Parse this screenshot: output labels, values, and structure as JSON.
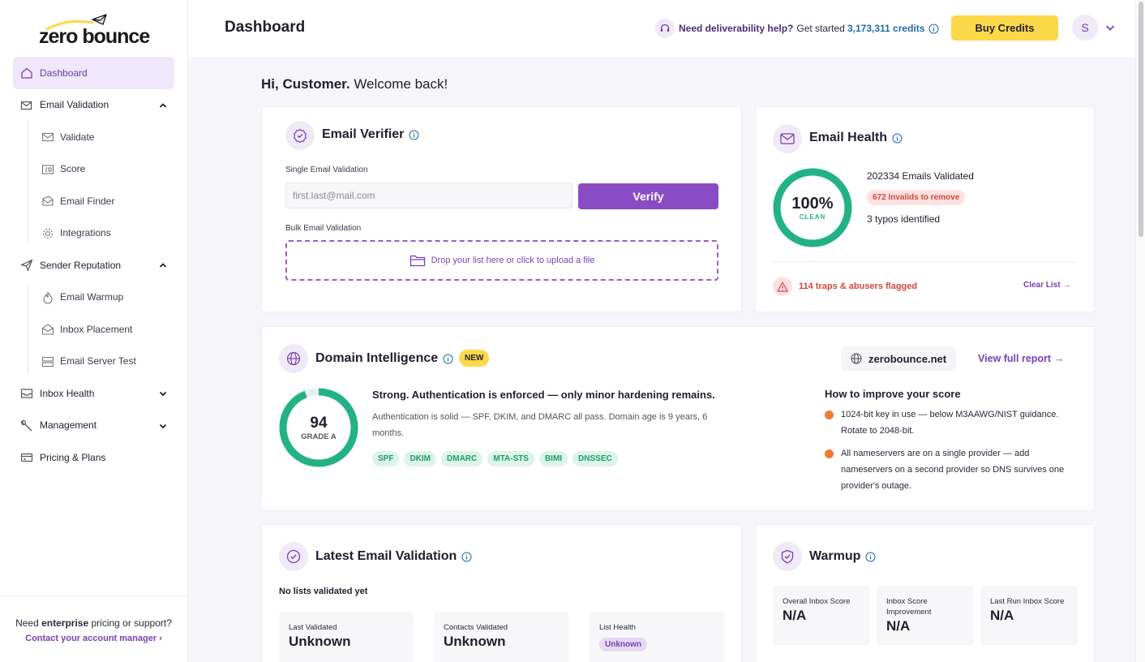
{
  "brand": {
    "logo_text": "zero bounce",
    "accent": "#8a4cc4",
    "yellow": "#fbd94a",
    "green": "#22b286"
  },
  "sidebar": {
    "items": [
      {
        "label": "Dashboard"
      },
      {
        "label": "Email Validation"
      },
      {
        "label": "Validate"
      },
      {
        "label": "Score"
      },
      {
        "label": "Email Finder"
      },
      {
        "label": "Integrations"
      },
      {
        "label": "Sender Reputation"
      },
      {
        "label": "Email Warmup"
      },
      {
        "label": "Inbox Placement"
      },
      {
        "label": "Email Server Test"
      },
      {
        "label": "Inbox Health"
      },
      {
        "label": "Management"
      },
      {
        "label": "Pricing & Plans"
      }
    ],
    "footer": {
      "pre": "Need ",
      "bold": "enterprise",
      "post": " pricing or support?",
      "link": "Contact your account manager ›"
    }
  },
  "header": {
    "title": "Dashboard",
    "help_bold": "Need deliverability help?",
    "help_link": "Get started",
    "credits": "3,173,311 credits",
    "buy_label": "Buy Credits",
    "avatar_initial": "S"
  },
  "greeting": {
    "bold": "Hi, Customer.",
    "rest": " Welcome back!"
  },
  "email_verifier": {
    "title": "Email Verifier",
    "single_label": "Single Email Validation",
    "input_placeholder": "first.last@mail.com",
    "verify_label": "Verify",
    "bulk_label": "Bulk Email Validation",
    "drop_text": "Drop your list here or click to upload a file"
  },
  "email_health": {
    "title": "Email Health",
    "percent": "100%",
    "percent_value": 100,
    "percent_label": "CLEAN",
    "validated": "202334 Emails Validated",
    "invalids": "672 Invalids to remove",
    "typos": "3 typos identified",
    "traps": "114 traps & abusers flagged",
    "clear_list": "Clear List →"
  },
  "domain_intelligence": {
    "title": "Domain Intelligence",
    "new_badge": "NEW",
    "domain": "zerobounce.net",
    "view_report": "View full report →",
    "score": "94",
    "score_value": 94,
    "grade": "GRADE A",
    "headline": "Strong. Authentication is enforced — only minor hardening remains.",
    "description": "Authentication is solid — SPF, DKIM, and DMARC all pass. Domain age is 9 years, 6 months.",
    "tags": [
      "SPF",
      "DKIM",
      "DMARC",
      "MTA-STS",
      "BIMI",
      "DNSSEC"
    ],
    "improve_title": "How to improve your score",
    "improvements": [
      "1024-bit key in use — below M3AAWG/NIST guidance. Rotate to 2048-bit.",
      "All nameservers are on a single provider — add nameservers on a second provider so DNS survives one provider's outage."
    ]
  },
  "latest_validation": {
    "title": "Latest Email Validation",
    "empty_text": "No lists validated yet",
    "stats": [
      {
        "label": "Last Validated",
        "value": "Unknown"
      },
      {
        "label": "Contacts Validated",
        "value": "Unknown"
      },
      {
        "label": "List Health",
        "value": "Unknown"
      }
    ]
  },
  "warmup": {
    "title": "Warmup",
    "stats": [
      {
        "label": "Overall Inbox Score",
        "value": "N/A"
      },
      {
        "label": "Inbox Score Improvement",
        "value": "N/A"
      },
      {
        "label": "Last Run Inbox Score",
        "value": "N/A"
      }
    ]
  }
}
